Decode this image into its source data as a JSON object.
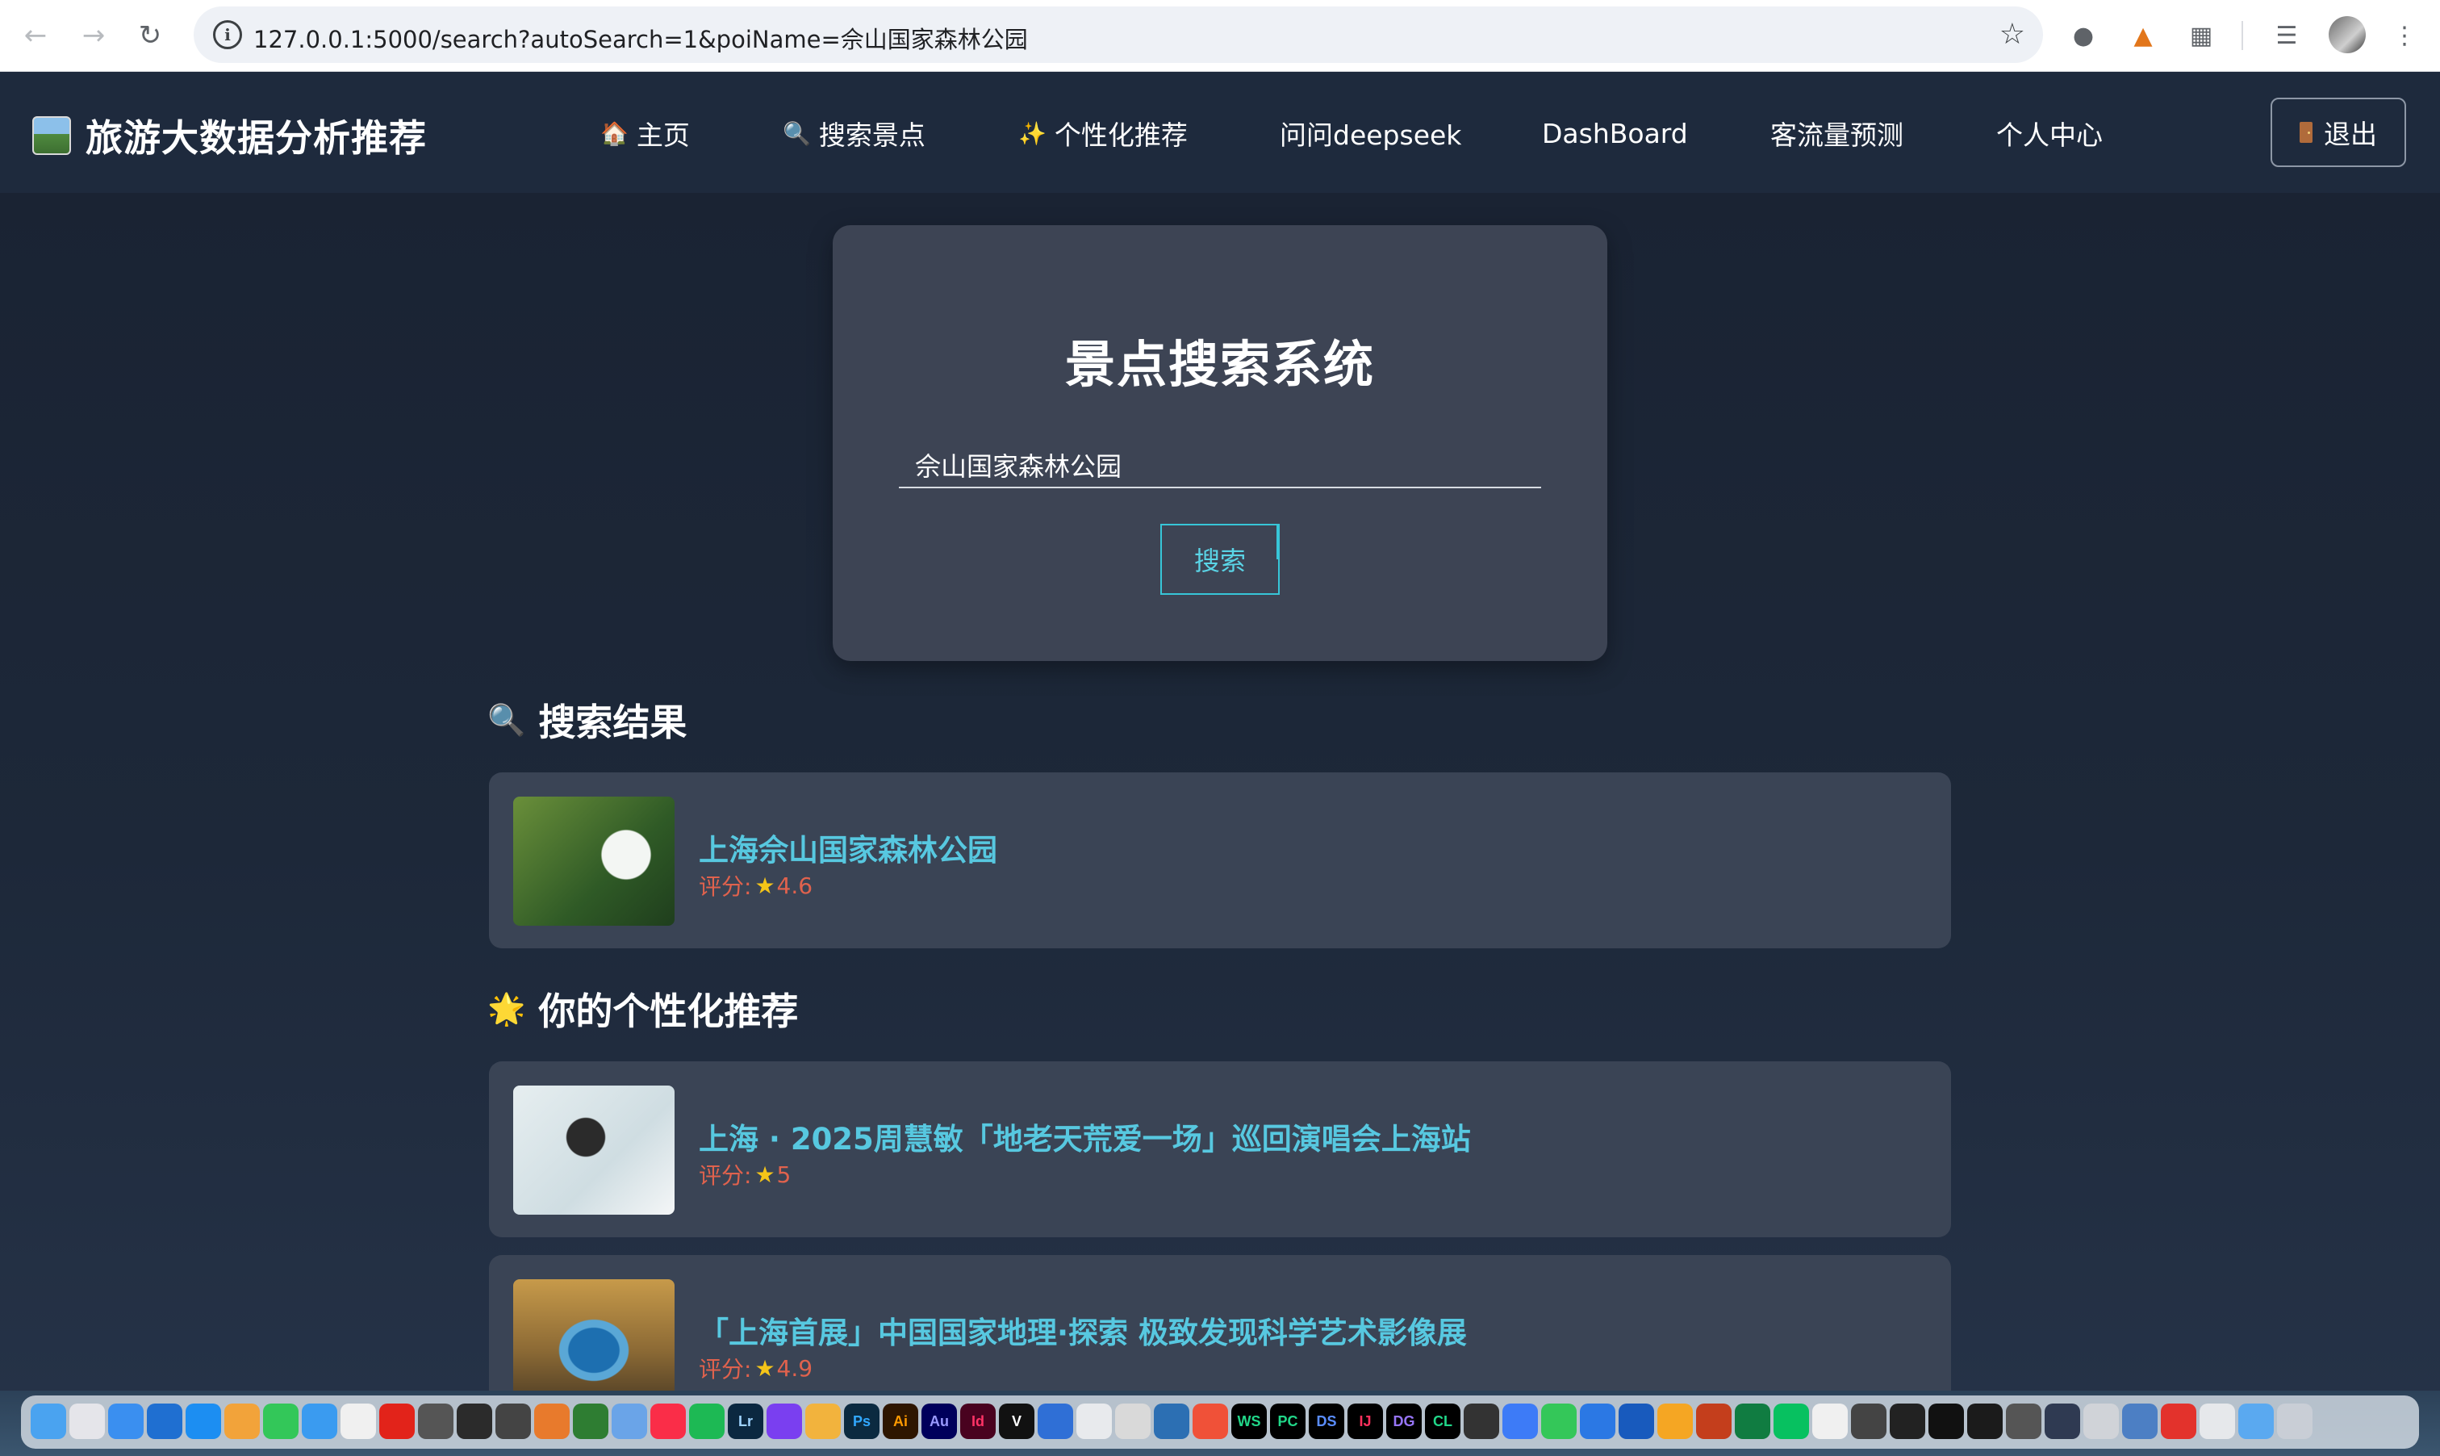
{
  "browser": {
    "url": "127.0.0.1:5000/search?autoSearch=1&poiName=佘山国家森林公园"
  },
  "header": {
    "brand": "旅游大数据分析推荐",
    "nav": [
      {
        "icon": "🏠",
        "label": "主页"
      },
      {
        "icon": "🔍",
        "label": "搜索景点"
      },
      {
        "icon": "✨",
        "label": "个性化推荐"
      },
      {
        "icon": "",
        "label": "问问deepseek"
      },
      {
        "icon": "",
        "label": "DashBoard"
      },
      {
        "icon": "",
        "label": "客流量预测"
      },
      {
        "icon": "",
        "label": "个人中心"
      }
    ],
    "logout": "退出"
  },
  "search": {
    "heading": "景点搜索系统",
    "query": "佘山国家森林公园",
    "button": "搜索"
  },
  "results": {
    "icon": "🔍",
    "title": "搜索结果",
    "items": [
      {
        "name": "上海佘山国家森林公园",
        "rating_label": "评分:",
        "rating": "4.6"
      }
    ]
  },
  "recommend": {
    "icon": "🌟",
    "title": "你的个性化推荐",
    "items": [
      {
        "name": "上海 · 2025周慧敏「地老天荒爱一场」巡回演唱会上海站",
        "rating_label": "评分:",
        "rating": "5"
      },
      {
        "name": "「上海首展」中国国家地理·探索 极致发现科学艺术影像展",
        "rating_label": "评分:",
        "rating": "4.9"
      }
    ]
  },
  "dock": {
    "icons": [
      "Lr",
      "Ps",
      "Ai",
      "Au",
      "Id",
      "V",
      "WS",
      "PC",
      "DS",
      "IJ",
      "DG",
      "CL"
    ]
  }
}
